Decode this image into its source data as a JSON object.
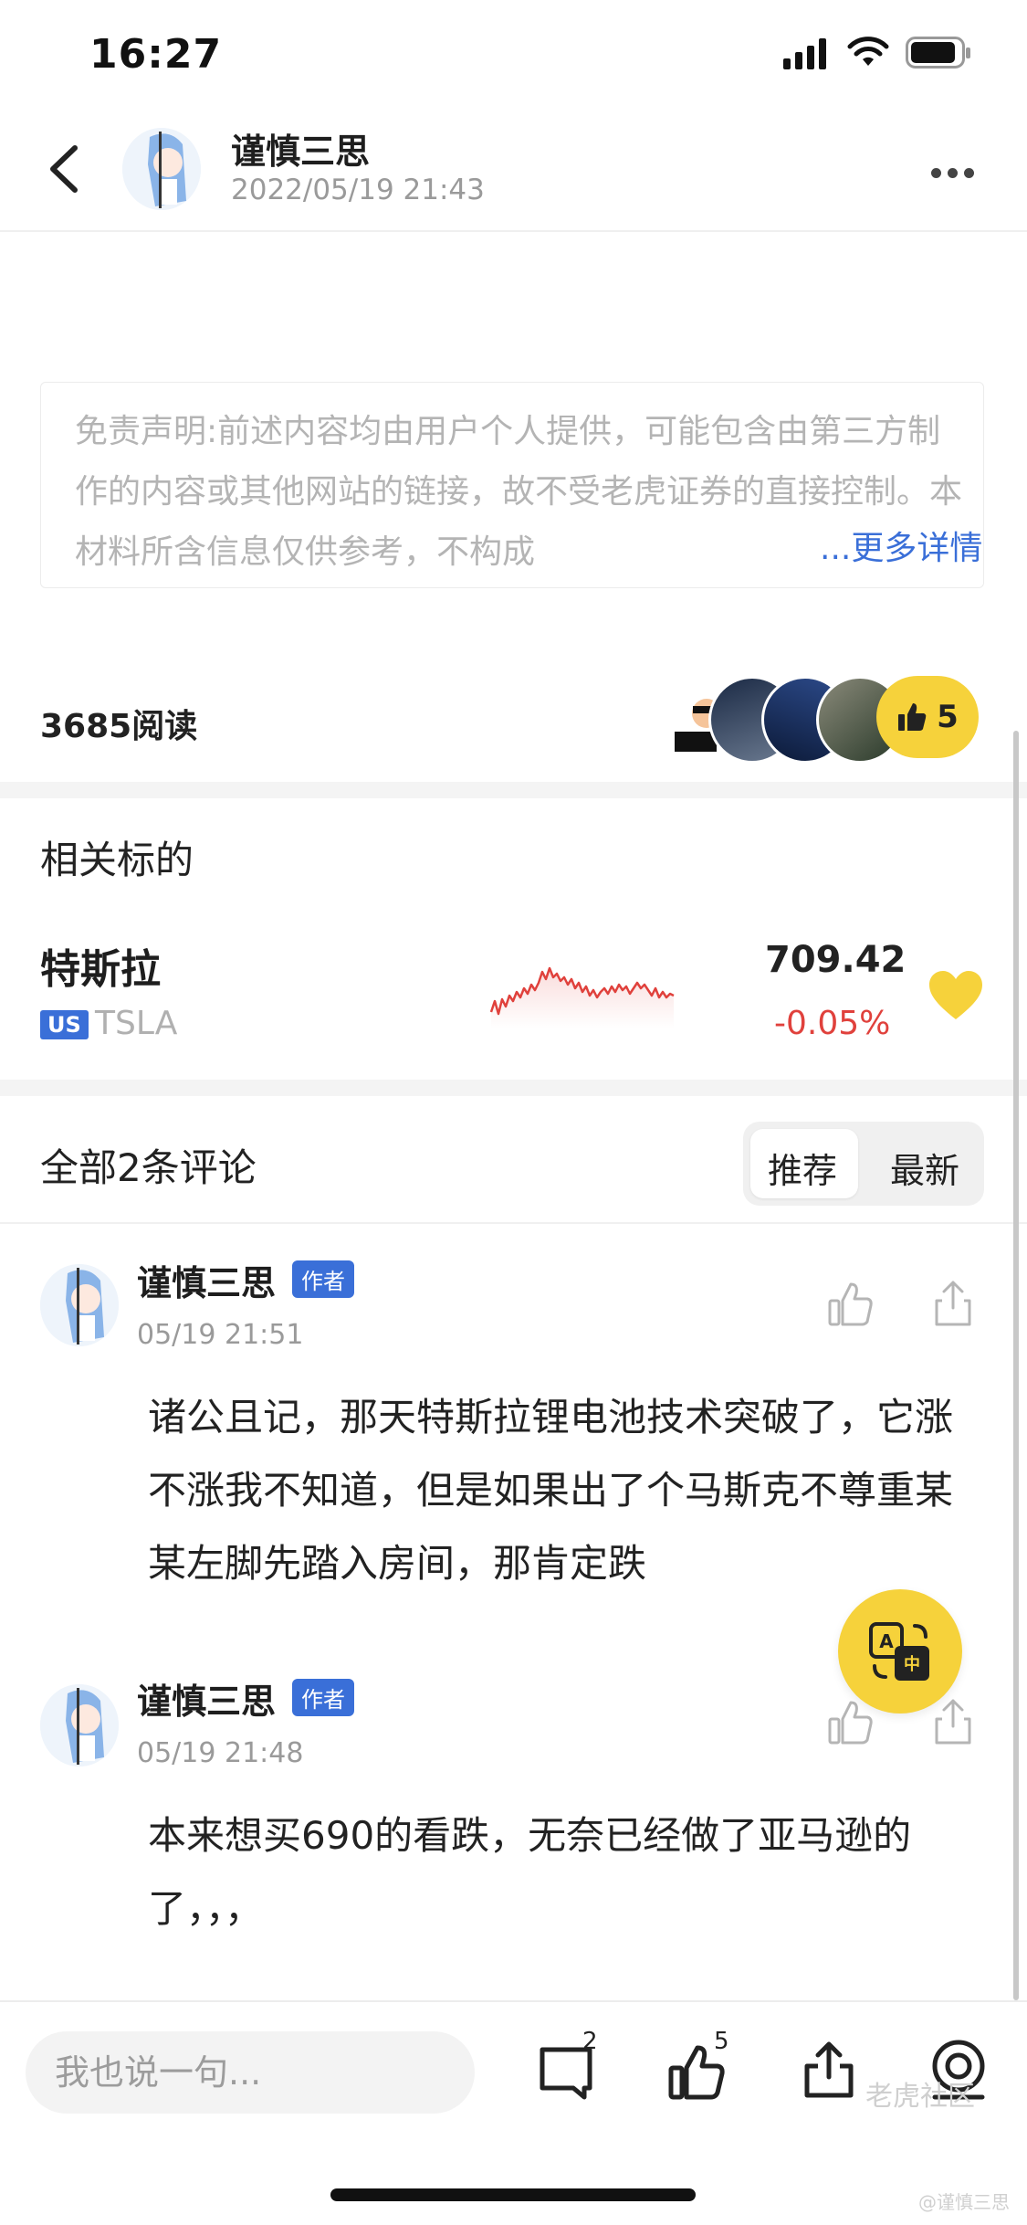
{
  "status_bar": {
    "time": "16:27"
  },
  "header": {
    "author_name": "谨慎三思",
    "post_time": "2022/05/19 21:43"
  },
  "disclaimer": {
    "text": "免责声明:前述内容均由用户个人提供，可能包含由第三方制作的内容或其他网站的链接，故不受老虎证券的直接控制。本材料所含信息仅供参考，不构成",
    "more_label": "...更多详情"
  },
  "stats": {
    "read_count": "3685阅读",
    "like_count": "5"
  },
  "related": {
    "title": "相关标的",
    "stock": {
      "name": "特斯拉",
      "market": "US",
      "ticker": "TSLA",
      "price": "709.42",
      "change": "-0.05%"
    }
  },
  "comments": {
    "title": "全部2条评论",
    "sort_options": [
      "推荐",
      "最新"
    ],
    "sort_selected": "推荐",
    "items": [
      {
        "name": "谨慎三思",
        "badge": "作者",
        "time": "05/19 21:51",
        "text": "诸公且记，那天特斯拉锂电池技术突破了，它涨不涨我不知道，但是如果出了个马斯克不尊重某某左脚先踏入房间，那肯定跌"
      },
      {
        "name": "谨慎三思",
        "badge": "作者",
        "time": "05/19 21:48",
        "text": "本来想买690的看跌，无奈已经做了亚马逊的了，，，"
      }
    ]
  },
  "bottom_bar": {
    "input_placeholder": "我也说一句...",
    "comment_count": "2",
    "like_count": "5"
  },
  "watermark": {
    "brand": "老虎社区",
    "user": "@谨慎三思"
  },
  "colors": {
    "accent_yellow": "#f6d23b",
    "link_blue": "#3a6fd8",
    "down_red": "#e0413c"
  }
}
